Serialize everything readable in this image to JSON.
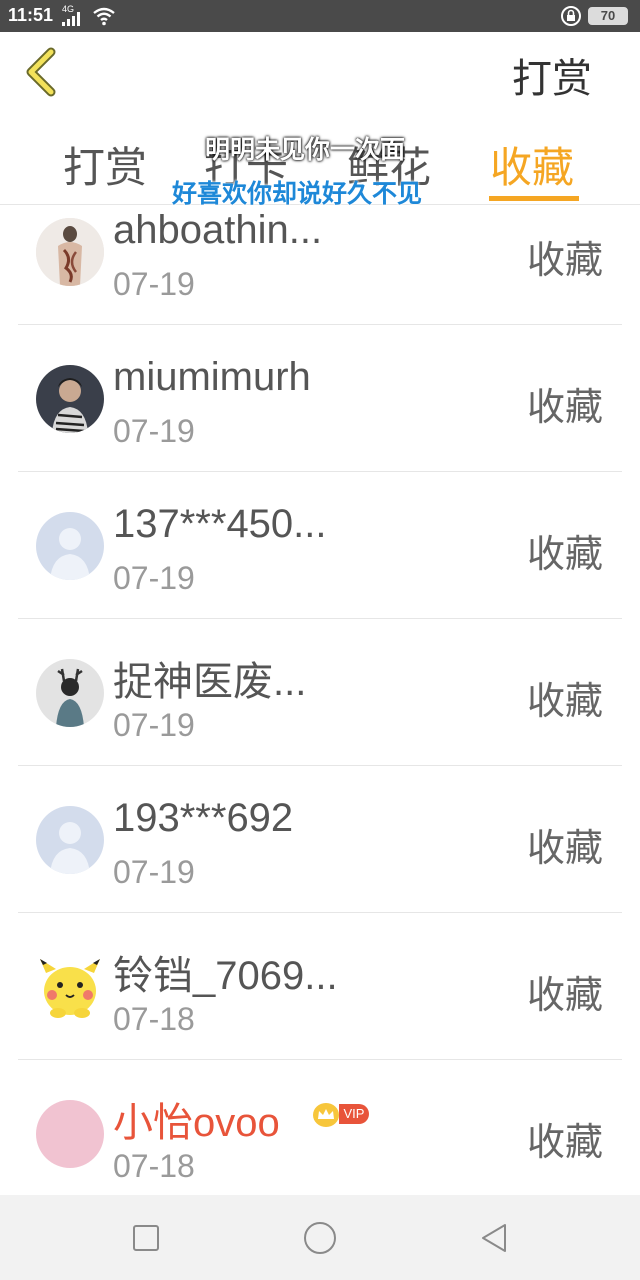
{
  "status_bar": {
    "time": "11:51",
    "network": "4G",
    "battery": "70",
    "icons": [
      "signal-icon",
      "wifi-icon",
      "lock-icon",
      "battery-icon"
    ]
  },
  "header": {
    "back_icon": "chevron-left-icon",
    "title": "打赏"
  },
  "tabs": {
    "items": [
      {
        "label": "打赏"
      },
      {
        "label": "打卡"
      },
      {
        "label": "鲜花"
      },
      {
        "label": "收藏"
      }
    ],
    "active": "收藏",
    "accent_color": "#f5a623"
  },
  "lyrics": {
    "line1": "明明未见你一次面",
    "line2": "好喜欢你却说好久不见"
  },
  "list": {
    "items": [
      {
        "name": "ahboathin...",
        "date": "07-19",
        "action": "收藏",
        "avatar": "tattoo-back-photo"
      },
      {
        "name": "miumimurh",
        "date": "07-19",
        "action": "收藏",
        "avatar": "person-photo"
      },
      {
        "name": "137***450...",
        "date": "07-19",
        "action": "收藏",
        "avatar": "default-user-avatar"
      },
      {
        "name": "捉神医废...",
        "date": "07-19",
        "action": "收藏",
        "avatar": "deer-head-person-photo"
      },
      {
        "name": "193***692",
        "date": "07-19",
        "action": "收藏",
        "avatar": "default-user-avatar"
      },
      {
        "name": "铃铛_7069...",
        "date": "07-18",
        "action": "收藏",
        "avatar": "pikachu-avatar"
      },
      {
        "name": "小怡ovoo",
        "date": "07-18",
        "action": "收藏",
        "avatar": "pink-avatar",
        "vip_label": "VIP"
      }
    ]
  },
  "nav_bar": {
    "icons": [
      "square-recent-icon",
      "circle-home-icon",
      "triangle-back-icon"
    ]
  }
}
